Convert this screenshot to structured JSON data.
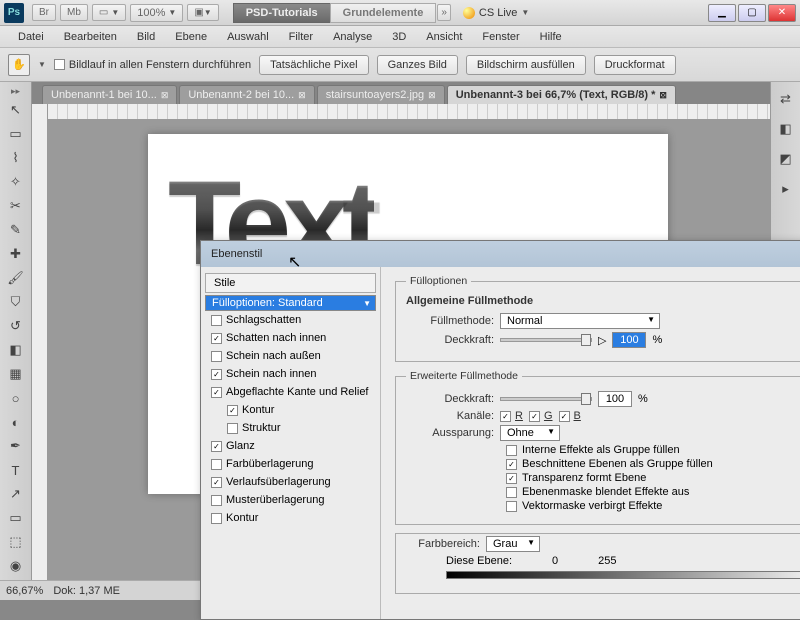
{
  "app": {
    "ps": "Ps",
    "br": "Br",
    "mb": "Mb",
    "zoom": "100%",
    "tabset": [
      "PSD-Tutorials",
      "Grundelemente"
    ],
    "active_tab": 0,
    "cslive": "CS Live"
  },
  "menu": [
    "Datei",
    "Bearbeiten",
    "Bild",
    "Ebene",
    "Auswahl",
    "Filter",
    "Analyse",
    "3D",
    "Ansicht",
    "Fenster",
    "Hilfe"
  ],
  "optbar": {
    "scroll_all": "Bildlauf in allen Fenstern durchführen",
    "b1": "Tatsächliche Pixel",
    "b2": "Ganzes Bild",
    "b3": "Bildschirm ausfüllen",
    "b4": "Druckformat"
  },
  "doctabs": [
    {
      "label": "Unbenannt-1 bei 10...",
      "active": false
    },
    {
      "label": "Unbenannt-2 bei 10...",
      "active": false
    },
    {
      "label": "stairsuntoayers2.jpg",
      "active": false
    },
    {
      "label": "Unbenannt-3 bei 66,7% (Text, RGB/8) *",
      "active": true
    }
  ],
  "canvas_text": "Text",
  "status": {
    "zoom": "66,67%",
    "doc": "Dok: 1,37 ME"
  },
  "dialog": {
    "title": "Ebenenstil",
    "styles_label": "Stile",
    "fill_default": "Fülloptionen: Standard",
    "items": [
      {
        "label": "Schlagschatten",
        "chk": false
      },
      {
        "label": "Schatten nach innen",
        "chk": true
      },
      {
        "label": "Schein nach außen",
        "chk": false
      },
      {
        "label": "Schein nach innen",
        "chk": true
      },
      {
        "label": "Abgeflachte Kante und Relief",
        "chk": true
      },
      {
        "label": "Kontur",
        "chk": true,
        "sub": true
      },
      {
        "label": "Struktur",
        "chk": false,
        "sub": true
      },
      {
        "label": "Glanz",
        "chk": true
      },
      {
        "label": "Farbüberlagerung",
        "chk": false
      },
      {
        "label": "Verlaufsüberlagerung",
        "chk": true
      },
      {
        "label": "Musterüberlagerung",
        "chk": false
      },
      {
        "label": "Kontur",
        "chk": false
      }
    ],
    "right": {
      "fill_title": "Fülloptionen",
      "sec1": "Allgemeine Füllmethode",
      "blend_lbl": "Füllmethode:",
      "blend_val": "Normal",
      "opac_lbl": "Deckkraft:",
      "opac_val": "100",
      "pct": "%",
      "sec2": "Erweiterte Füllmethode",
      "opac2_lbl": "Deckkraft:",
      "opac2_val": "100",
      "chan_lbl": "Kanäle:",
      "chR": "R",
      "chG": "G",
      "chB": "B",
      "knock_lbl": "Aussparung:",
      "knock_val": "Ohne",
      "adv": [
        {
          "chk": false,
          "label": "Interne Effekte als Gruppe füllen"
        },
        {
          "chk": true,
          "label": "Beschnittene Ebenen als Gruppe füllen"
        },
        {
          "chk": true,
          "label": "Transparenz formt Ebene"
        },
        {
          "chk": false,
          "label": "Ebenenmaske blendet Effekte aus"
        },
        {
          "chk": false,
          "label": "Vektormaske verbirgt Effekte"
        }
      ],
      "sec3_lbl": "Farbbereich:",
      "sec3_val": "Grau",
      "this_layer": "Diese Ebene:",
      "tl_lo": "0",
      "tl_hi": "255"
    }
  }
}
